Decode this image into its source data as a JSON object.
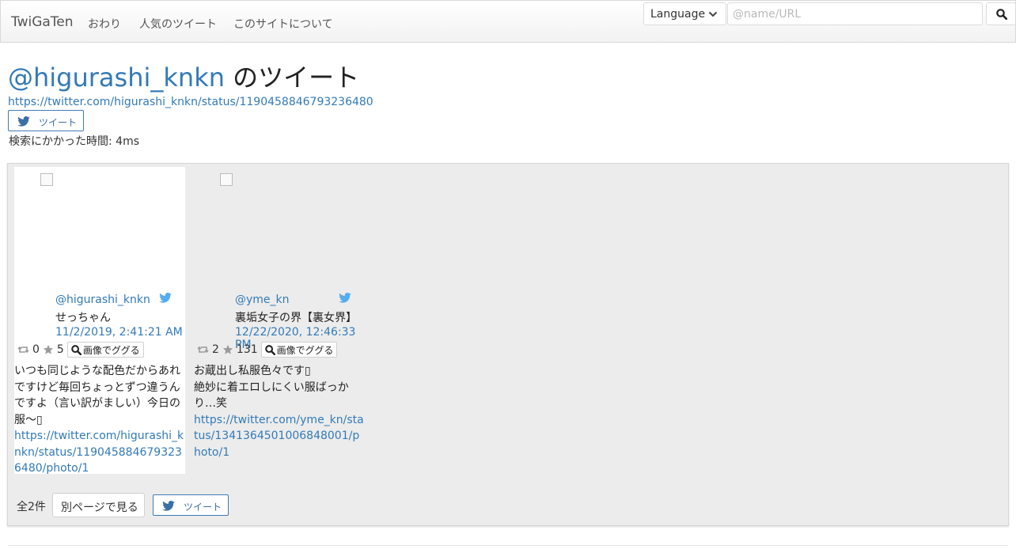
{
  "navbar": {
    "brand": "TwiGaTen",
    "links": [
      "おわり",
      "人気のツイート",
      "このサイトについて"
    ],
    "language_label": "Language",
    "search_placeholder": "@name/URL",
    "search_value": ""
  },
  "header": {
    "username": "@higurashi_knkn",
    "title_suffix": " のツイート",
    "status_url": "https://twitter.com/higurashi_knkn/status/1190458846793236480",
    "tweet_button": "ツイート",
    "search_time": "検索にかかった時間: 4ms"
  },
  "cards": [
    {
      "username": "@higurashi_knkn",
      "display_name": "せっちゃん",
      "date": "11/2/2019, 2:41:21 AM",
      "retweets": "0",
      "likes": "5",
      "google_button": "画像でググる",
      "text": "いつも同じような配色だからあれですけど毎回ちょっとずつ違うんですよ（言い訳がましい）今日の服〜▯",
      "photo_url": "https://twitter.com/higurashi_knkn/status/1190458846793236480/photo/1"
    },
    {
      "username": "@yme_kn",
      "display_name": "裏垢女子の界【裏女界】",
      "date": "12/22/2020, 12:46:33 PM",
      "retweets": "2",
      "likes": "131",
      "google_button": "画像でググる",
      "text": "お蔵出し私服色々です▯\n絶妙に着エロしにくい服ばっかり…笑",
      "photo_url": "https://twitter.com/yme_kn/status/1341364501006848001/photo/1"
    }
  ],
  "footer": {
    "count": "全2件",
    "separate_page_button": "別ページで見る",
    "tweet_button": "ツイート"
  },
  "colors": {
    "link": "#337ab7",
    "twitter": "#55acee",
    "panel_bg": "#ececec"
  }
}
